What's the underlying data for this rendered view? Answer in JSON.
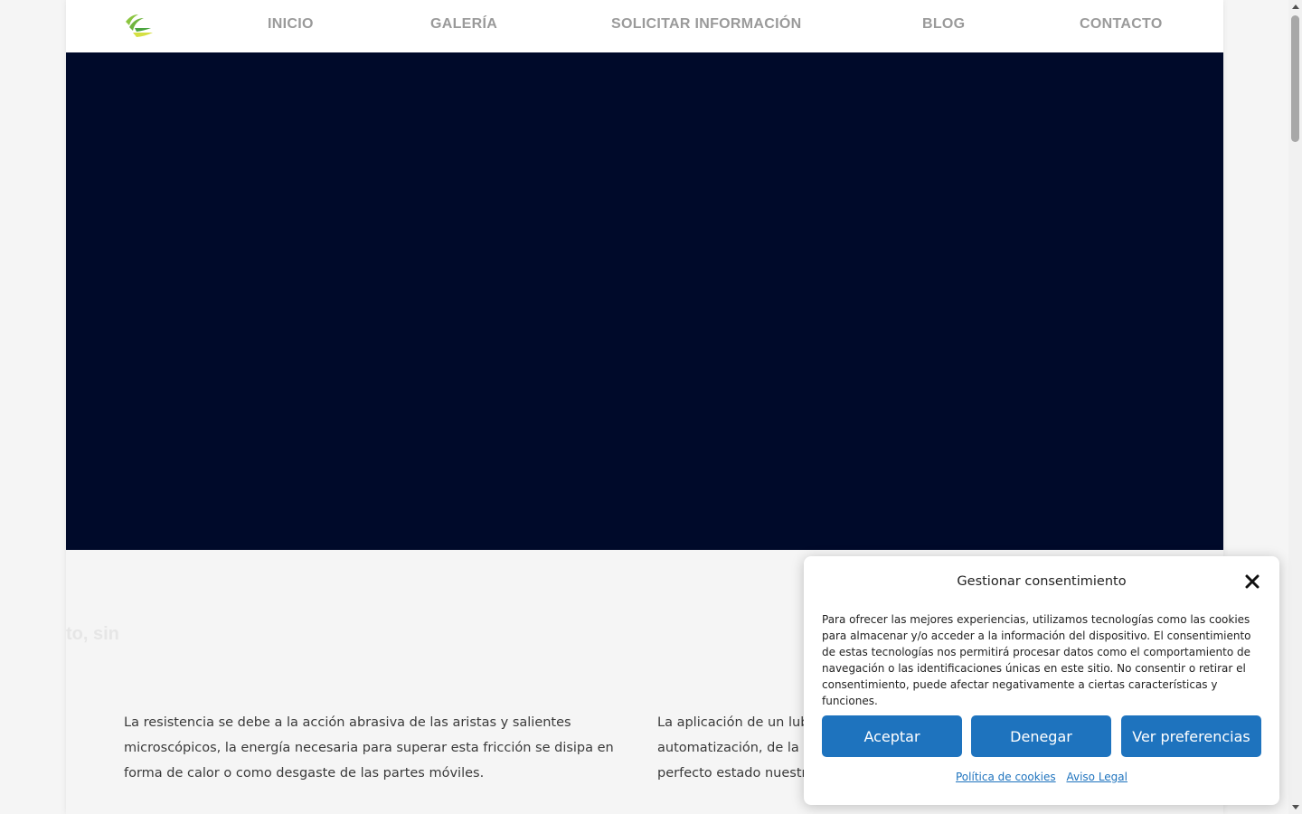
{
  "nav": {
    "logo_icon": "leaf-logo-icon",
    "items": [
      "INICIO",
      "GALERÍA",
      "SOLICITAR INFORMACIÓN",
      "BLOG",
      "CONTACTO"
    ]
  },
  "hero": {
    "background": "#000a2a"
  },
  "content": {
    "heading_fragment": "to, sin",
    "col_left": "La resistencia se debe a la acción abrasiva de las aristas y salientes microscópicos, la energía necesaria para superar esta fricción se disipa en forma de calor o como desgaste de las partes móviles.",
    "col_right": "La aplicación de un lubric\nautomatización, de la apl\nperfecto estado nuestros"
  },
  "consent": {
    "title": "Gestionar consentimiento",
    "body": "Para ofrecer las mejores experiencias, utilizamos tecnologías como las cookies para almacenar y/o acceder a la información del dispositivo. El consentimiento de estas tecnologías nos permitirá procesar datos como el comportamiento de navegación o las identificaciones únicas en este sitio. No consentir o retirar el consentimiento, puede afectar negativamente a ciertas características y funciones.",
    "accept_label": "Aceptar",
    "deny_label": "Denegar",
    "prefs_label": "Ver preferencias",
    "cookie_policy_link": "Política de cookies",
    "legal_notice_link": "Aviso Legal",
    "accent_color": "#1e73be"
  }
}
